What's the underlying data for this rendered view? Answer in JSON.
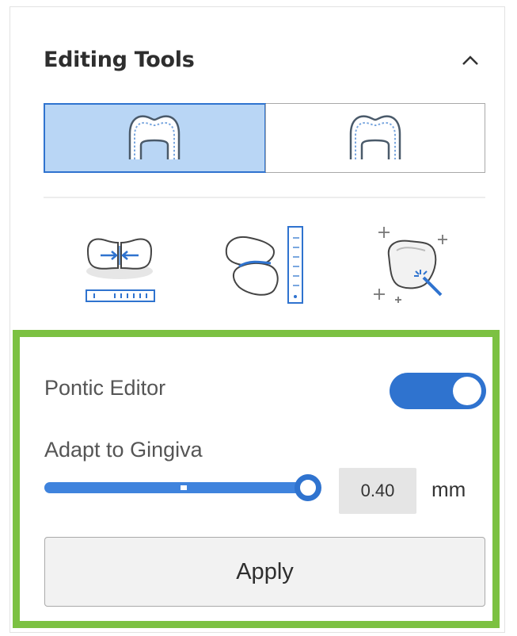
{
  "panel": {
    "title": "Editing Tools",
    "collapse_icon": "chevron-up-icon"
  },
  "view_modes": [
    {
      "icon": "tooth-crown-solid-icon",
      "active": true
    },
    {
      "icon": "tooth-crown-outline-icon",
      "active": false
    }
  ],
  "tools": [
    {
      "icon": "contact-adjust-icon"
    },
    {
      "icon": "occlusion-measure-icon"
    },
    {
      "icon": "smart-shape-icon"
    }
  ],
  "pontic": {
    "label": "Pontic Editor",
    "enabled": true,
    "adapt_label": "Adapt to Gingiva",
    "value": "0.40",
    "unit": "mm",
    "apply_label": "Apply"
  },
  "colors": {
    "accent": "#2f73cf",
    "active_fill": "#b9d6f5",
    "highlight_border": "#7cc142"
  }
}
